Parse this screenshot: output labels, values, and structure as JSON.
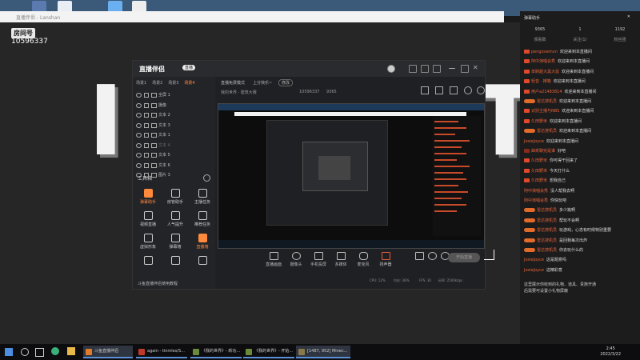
{
  "top": {
    "title_strip": "直播伴侣 - Lanshan"
  },
  "stage": {
    "room_tag": "房间号",
    "room_no": "10596337",
    "big_letters": [
      "I",
      "T"
    ]
  },
  "app": {
    "logo": "直播伴侣",
    "logo_badge": "直播",
    "tabs": [
      "场景1",
      "场景2",
      "场景3",
      "场景4"
    ],
    "active_tab_index": 3,
    "layers": [
      {
        "name": "全屏 1",
        "dim": false
      },
      {
        "name": "摄像",
        "dim": false
      },
      {
        "name": "文本 2",
        "dim": false
      },
      {
        "name": "文本 3",
        "dim": false
      },
      {
        "name": "文本 1",
        "dim": false
      },
      {
        "name": "文本 4",
        "dim": true
      },
      {
        "name": "文本 5",
        "dim": false
      },
      {
        "name": "文本 6",
        "dim": false
      },
      {
        "name": "图片 3",
        "dim": false
      }
    ],
    "tools_title": "工具箱",
    "tools": [
      {
        "label": "弹幕助手",
        "orange": true
      },
      {
        "label": "房管助手",
        "orange": false
      },
      {
        "label": "主播任务",
        "orange": false
      },
      {
        "label": "视频直播",
        "orange": false
      },
      {
        "label": "人气提升",
        "orange": false
      },
      {
        "label": "推荐任务",
        "orange": false
      },
      {
        "label": "虚拟形象",
        "orange": false
      },
      {
        "label": "弹幕墙",
        "orange": false
      },
      {
        "label": "直播墙",
        "orange": true
      },
      {
        "label": "",
        "orange": false
      },
      {
        "label": "",
        "orange": false
      },
      {
        "label": "",
        "orange": false
      }
    ],
    "bottom_note": "斗鱼直播伴侣使用教程",
    "header": {
      "room_title": "直播免费模式",
      "room_sub": "我的世界 · 建筑大赛",
      "category": "上分快乐~",
      "edit": "修改",
      "room_id": "10596337",
      "viewers": "9365"
    },
    "bottom_buttons": [
      "直播画面",
      "摄像头",
      "手机投屏",
      "多媒体",
      "麦克风",
      "扬声器"
    ],
    "start_live": "开始直播",
    "status": [
      "CPU: 12%",
      "内存: 38%",
      "FPS: 30",
      "码率: 2500kbps"
    ]
  },
  "chat": {
    "header": "弹幕助手",
    "stats": [
      {
        "value": "9365",
        "label": "观看数"
      },
      {
        "value": "1",
        "label": "关注(1)"
      },
      {
        "value": "1192",
        "label": "粉丝团"
      }
    ],
    "messages": [
      {
        "badge": "s",
        "user": "pengzswmvn",
        "text": "欢迎来到本直播间"
      },
      {
        "badge": "s",
        "user": "阿中演唱会秀",
        "text": "欢迎来到本直播间"
      },
      {
        "badge": "s",
        "user": "单刷超大黑大鼠",
        "text": "欢迎来到本直播间"
      },
      {
        "badge": "s",
        "user": "轻音 · 推箱",
        "text": "欢迎来到本直播间"
      },
      {
        "badge": "s",
        "user": "用户a21483814",
        "text": "欢迎来到本直播间"
      },
      {
        "badge": "p",
        "user": "雷达搜机员",
        "text": "欢迎来到本直播间"
      },
      {
        "badge": "s",
        "user": "识别主播与NBS",
        "text": "欢迎来到本直播间"
      },
      {
        "badge": "s",
        "user": "久田野米",
        "text": "欢迎来到本直播间"
      },
      {
        "badge": "p",
        "user": "雷达搜机员",
        "text": "欢迎来到本直播间"
      },
      {
        "badge": "",
        "user": "JosieJoyce",
        "text": "欢迎来到本直播间"
      },
      {
        "badge": "d",
        "user": "曲奇聊完是谁",
        "text": "好吧"
      },
      {
        "badge": "s",
        "user": "久田野米",
        "text": "你可得干回来了"
      },
      {
        "badge": "s",
        "user": "久田野米",
        "text": "今天打什么"
      },
      {
        "badge": "s",
        "user": "久田野米",
        "text": "想我自己"
      },
      {
        "badge": "",
        "user": "阿中演唱会秀",
        "text": "没人帮我去啊"
      },
      {
        "badge": "",
        "user": "阿中演唱会秀",
        "text": "你快玩吧"
      },
      {
        "badge": "p",
        "user": "雷达搜机员",
        "text": "多少篇啊"
      },
      {
        "badge": "p",
        "user": "雷达搜机员",
        "text": "帮玩不会啊"
      },
      {
        "badge": "p",
        "user": "雷达搜机员",
        "text": "玩游戏，心态有时候特别重要"
      },
      {
        "badge": "p",
        "user": "雷达搜机员",
        "text": "是回我每次出炸"
      },
      {
        "badge": "p",
        "user": "雷达搜机员",
        "text": "你去玩什么的"
      },
      {
        "badge": "",
        "user": "JosieJoyce",
        "text": "这是题意吗"
      },
      {
        "badge": "",
        "user": "JosieJoyce",
        "text": "这精彩意"
      }
    ],
    "footer": "这里展示你收到的礼物、道具、贵族开通\n后需要可设置小礼物屏蔽"
  },
  "taskbar": {
    "items": [
      {
        "label": "斗鱼直播伴侣",
        "color": "#e07b2a",
        "active": true
      },
      {
        "label": "again - tinmles/S...",
        "color": "#c0392b",
        "active": false
      },
      {
        "label": "《我的世界》- 新功...",
        "color": "#6a8a3a",
        "active": false
      },
      {
        "label": "《我的世界》- 开始...",
        "color": "#6a8a3a",
        "active": false
      },
      {
        "label": "[1487, 952] Minec...",
        "color": "#8a7a4a",
        "active": true
      }
    ],
    "time": "2:45",
    "date": "2022/3/22"
  },
  "colors": {
    "accent": "#ff8a3c",
    "chat_user": "#e6623a"
  }
}
